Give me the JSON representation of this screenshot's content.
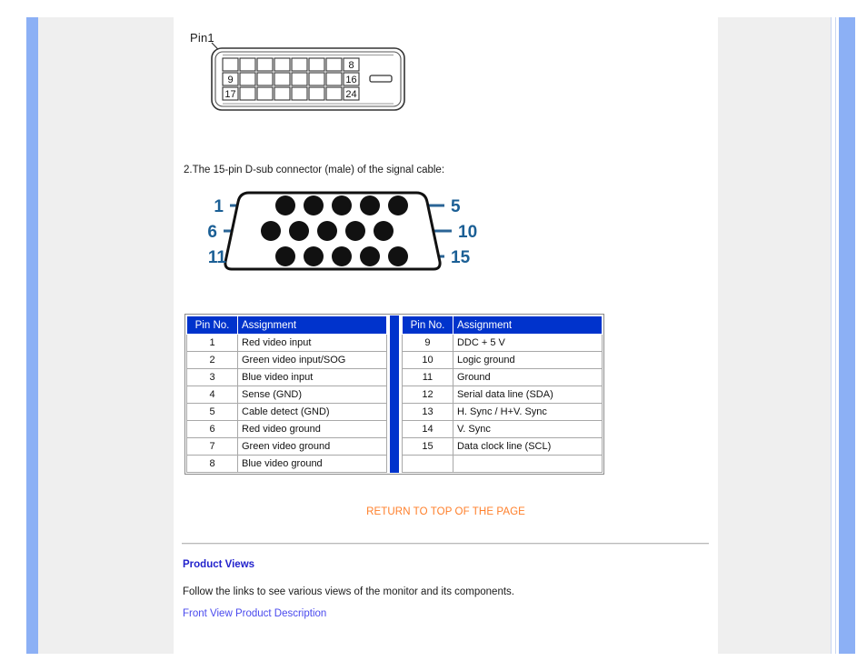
{
  "page": {
    "accent_blue": "#0033cc",
    "edge_blue": "#8cb0f5",
    "panel_gray": "#efefef",
    "link_orange": "#ff7f2a",
    "link_blue": "#4a4aee",
    "heading_blue": "#2222cc"
  },
  "dvi": {
    "pin1_label": "Pin1",
    "row_end_labels": [
      "8",
      "16",
      "24"
    ],
    "row_start_labels": [
      "",
      "9",
      "17"
    ],
    "rows": 3,
    "pins_per_row": 8
  },
  "dsub": {
    "caption": "2.The 15-pin D-sub connector (male) of the signal cable:",
    "left_labels": [
      "1",
      "6",
      "11"
    ],
    "right_labels": [
      "5",
      "10",
      "15"
    ],
    "rows": 3,
    "pins_per_row": 5
  },
  "tables": {
    "headers": {
      "pin": "Pin No.",
      "assignment": "Assignment"
    },
    "left_rows": [
      {
        "pin": "1",
        "assignment": "Red video input"
      },
      {
        "pin": "2",
        "assignment": "Green video input/SOG"
      },
      {
        "pin": "3",
        "assignment": "Blue video input"
      },
      {
        "pin": "4",
        "assignment": "Sense (GND)"
      },
      {
        "pin": "5",
        "assignment": "Cable detect (GND)"
      },
      {
        "pin": "6",
        "assignment": "Red video ground"
      },
      {
        "pin": "7",
        "assignment": "Green video ground"
      },
      {
        "pin": "8",
        "assignment": "Blue video ground"
      }
    ],
    "right_rows": [
      {
        "pin": "9",
        "assignment": "DDC + 5 V"
      },
      {
        "pin": "10",
        "assignment": "Logic ground"
      },
      {
        "pin": "11",
        "assignment": "Ground"
      },
      {
        "pin": "12",
        "assignment": "Serial data line (SDA)"
      },
      {
        "pin": "13",
        "assignment": "H. Sync / H+V. Sync"
      },
      {
        "pin": "14",
        "assignment": "V. Sync"
      },
      {
        "pin": "15",
        "assignment": "Data clock line (SCL)"
      }
    ]
  },
  "footer": {
    "return_to_top": "RETURN TO TOP OF THE PAGE",
    "product_views_heading": "Product Views",
    "product_views_text": "Follow the links to see various views of the monitor and its components.",
    "front_view_link": "Front View Product Description"
  }
}
